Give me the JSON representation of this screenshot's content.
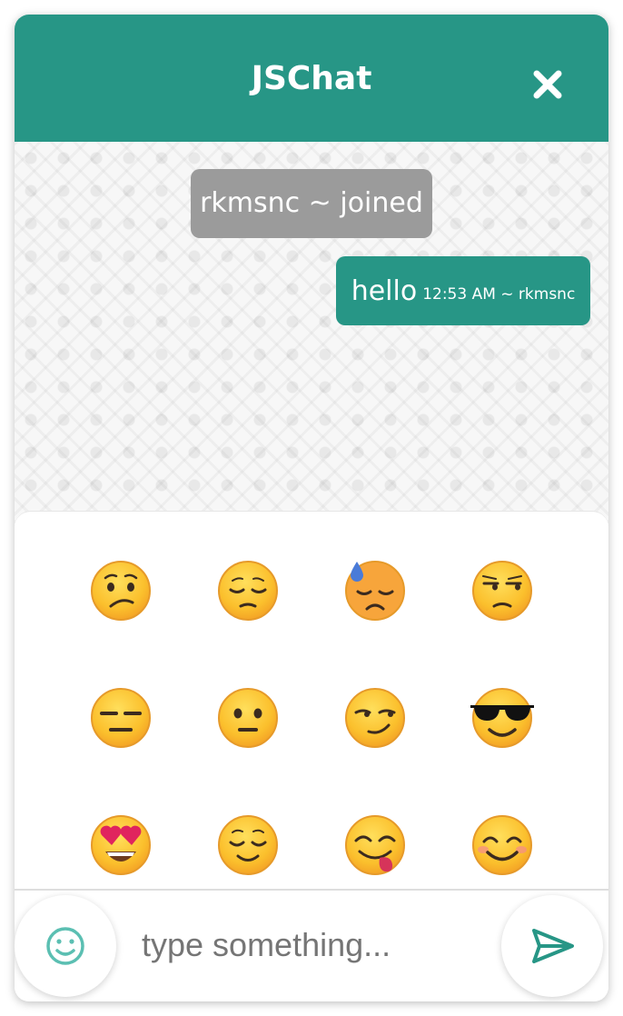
{
  "header": {
    "title": "JSChat",
    "close_icon": "close-icon"
  },
  "chat": {
    "messages": [
      {
        "type": "system",
        "text": "rkmsnc ~ joined"
      },
      {
        "type": "outgoing",
        "text": "hello",
        "meta": "12:53 AM ~ rkmsnc"
      }
    ]
  },
  "emoji_picker": {
    "emojis": [
      "confused-face",
      "pensive-face",
      "downcast-face-with-sweat",
      "unamused-face",
      "expressionless-face",
      "neutral-face",
      "smirking-face",
      "smiling-face-with-sunglasses",
      "smiling-face-with-heart-eyes",
      "relieved-face",
      "face-savoring-food",
      "smiling-face-with-smiling-eyes"
    ]
  },
  "composer": {
    "placeholder": "type something...",
    "value": "",
    "emoji_toggle_icon": "smiley-icon",
    "send_icon": "send-icon"
  },
  "colors": {
    "accent": "#279686",
    "system_bubble": "#9b9b9b",
    "emoji_face": "#fbc02d",
    "emoji_outline": "#e69a2a",
    "emoji_toggle": "#5bbfb2"
  }
}
